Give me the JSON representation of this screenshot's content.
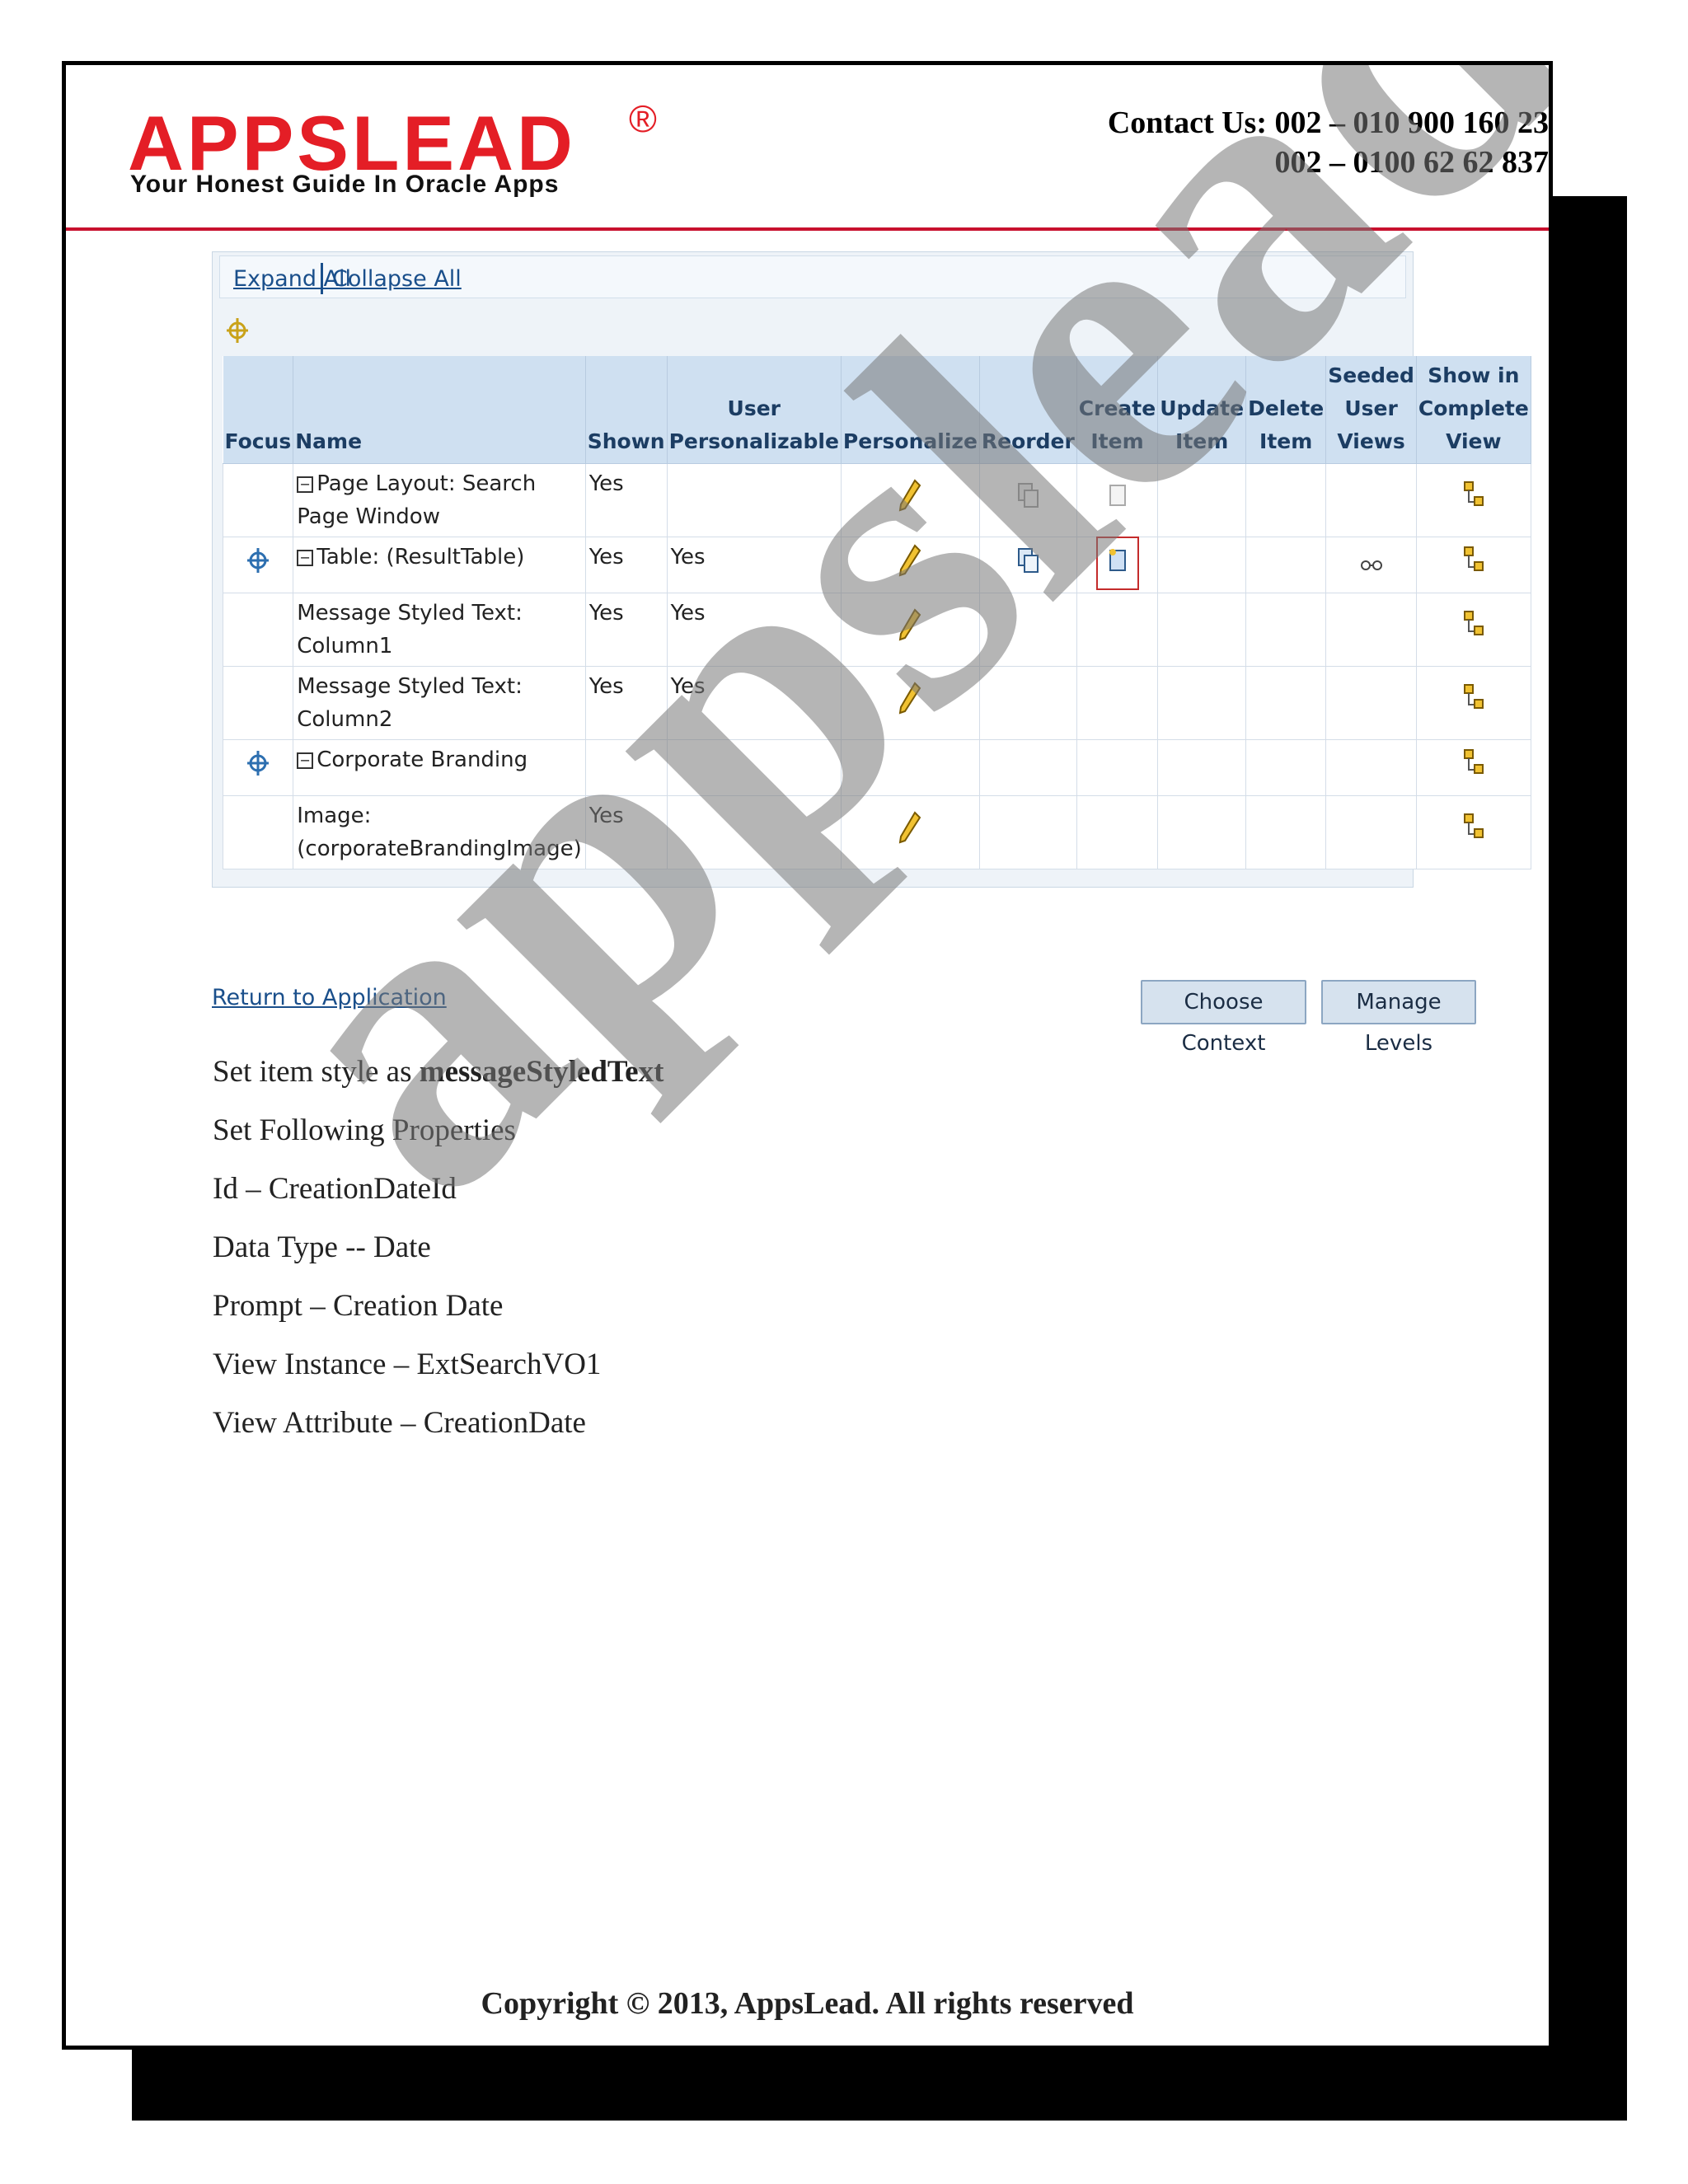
{
  "header": {
    "logo_text": "APPSLEAD",
    "logo_reg": "®",
    "tagline": "Your Honest Guide In Oracle Apps",
    "contact_line1": "Contact Us: 002 – 010 900 160 23",
    "contact_line2": "002 – 0100 62 62 837"
  },
  "colors": {
    "brand_red": "#e41e26",
    "header_rule": "#c8102e",
    "table_header": "#cfe0f1",
    "link": "#1a4f8b"
  },
  "screenshot": {
    "expand_all": "Expand All",
    "collapse_all": "Collapse All",
    "columns": {
      "focus": "Focus",
      "name": "Name",
      "shown": "Shown",
      "user_personalizable": "User Personalizable",
      "personalize": "Personalize",
      "reorder": "Reorder",
      "create_item": "Create Item",
      "update_item": "Update Item",
      "delete_item": "Delete Item",
      "seeded_user_views": "Seeded User Views",
      "show_in_complete_view": "Show in Complete View"
    },
    "rows": [
      {
        "name": "Page Layout: Search Page Window",
        "shown": "Yes",
        "user_personalizable": ""
      },
      {
        "name": "Table: (ResultTable)",
        "shown": "Yes",
        "user_personalizable": "Yes"
      },
      {
        "name": "Message Styled Text: Column1",
        "shown": "Yes",
        "user_personalizable": "Yes"
      },
      {
        "name": "Message Styled Text: Column2",
        "shown": "Yes",
        "user_personalizable": "Yes"
      },
      {
        "name": "Corporate Branding",
        "shown": "",
        "user_personalizable": ""
      },
      {
        "name": "Image: (corporateBrandingImage)",
        "shown": "Yes",
        "user_personalizable": ""
      }
    ],
    "return_link": "Return to Application",
    "choose_context": "Choose Context",
    "manage_levels": "Manage Levels"
  },
  "body": {
    "line1_prefix": "Set item style as ",
    "line1_bold": "messageStyledText",
    "line2": "Set Following Properties",
    "line3": "Id – CreationDateId",
    "line4": "Data Type -- Date",
    "line5": "Prompt – Creation Date",
    "line6": "View Instance – ExtSearchVO1",
    "line7": "View Attribute – CreationDate"
  },
  "watermark": "appslead",
  "footer": {
    "copyright": "Copyright © 2013, AppsLead. All rights reserved"
  }
}
